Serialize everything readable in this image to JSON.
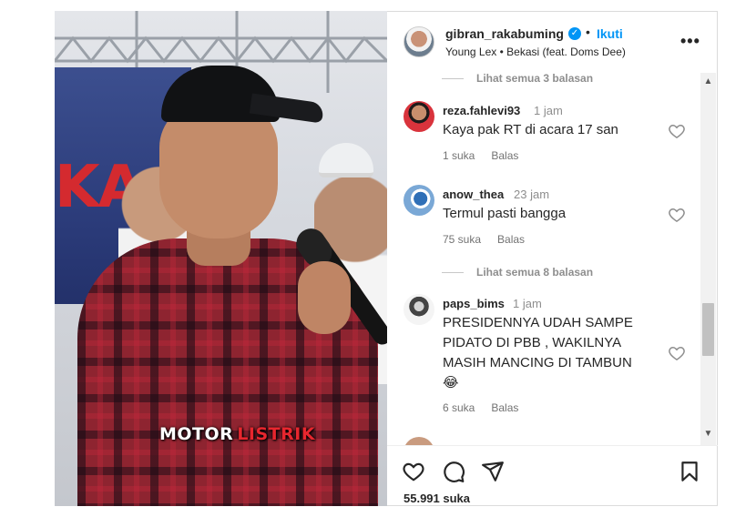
{
  "photo": {
    "banner_text": "KA",
    "caption_brand": "MOTOR",
    "caption_brand_accent": "LISTRIK"
  },
  "post": {
    "username": "gibran_rakabuming",
    "follow_label": "Ikuti",
    "separator": "•",
    "music": "Young Lex • Bekasi (feat. Doms Dee)",
    "more_label": "•••"
  },
  "comments": {
    "view_replies_top": "Lihat semua 3 balasan",
    "view_replies_mid": "Lihat semua 8 balasan",
    "items": [
      {
        "user": "reza.fahlevi93",
        "time": "1 jam",
        "text": "Kaya pak RT di acara 17 san",
        "likes": "1 suka",
        "reply": "Balas"
      },
      {
        "user": "anow_thea",
        "time": "23 jam",
        "text": "Termul pasti bangga",
        "likes": "75 suka",
        "reply": "Balas"
      },
      {
        "user": "paps_bims",
        "time": "1 jam",
        "text": "PRESIDENNYA UDAH SAMPE PIDATO DI PBB , WAKILNYA MASIH MANCING DI TAMBUN",
        "emoji": "😂",
        "likes": "6 suka",
        "reply": "Balas"
      }
    ]
  },
  "footer": {
    "likes_count": "55.991 suka"
  },
  "icons": [
    "verified-badge-icon",
    "heart-icon",
    "comment-icon",
    "share-icon",
    "save-icon",
    "more-icon"
  ],
  "colors": {
    "link_blue": "#0095f6",
    "text": "#262626",
    "muted": "#737373",
    "brand_accent": "#e8262e"
  }
}
